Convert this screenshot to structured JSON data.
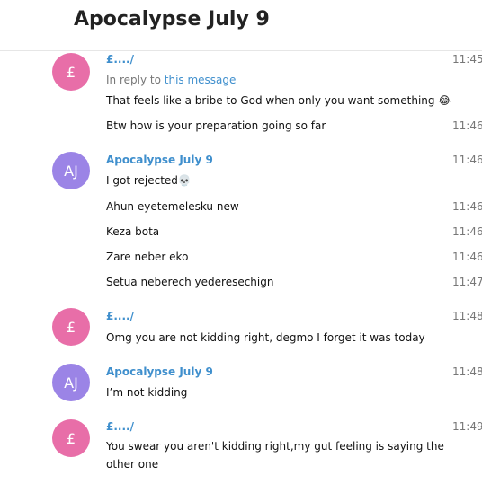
{
  "header": {
    "title": "Apocalypse July 9"
  },
  "colors": {
    "pound_avatar": "#e86ea8",
    "aj_avatar": "#9b84e6",
    "name": "#3f8fcd"
  },
  "groups": [
    {
      "avatar": "£",
      "sender": "£..../",
      "time": "11:45",
      "reply": {
        "prefix": "In reply to",
        "link": "this message"
      },
      "messages": [
        {
          "text": "That feels like a bribe to God when only you want something 😂"
        },
        {
          "text": "Btw how is your preparation going so far",
          "time": "11:46"
        }
      ]
    },
    {
      "avatar": "AJ",
      "sender": "Apocalypse July 9",
      "time": "11:46",
      "messages": [
        {
          "text": "I got rejected💀"
        },
        {
          "text": "Ahun eyetemelesku new",
          "time": "11:46"
        },
        {
          "text": "Keza bota",
          "time": "11:46"
        },
        {
          "text": "Zare neber eko",
          "time": "11:46"
        },
        {
          "text": "Setua neberech yederesechign",
          "time": "11:47"
        }
      ]
    },
    {
      "avatar": "£",
      "sender": "£..../",
      "time": "11:48",
      "messages": [
        {
          "text": "Omg you are not kidding right, degmo I forget it was today"
        }
      ]
    },
    {
      "avatar": "AJ",
      "sender": "Apocalypse July 9",
      "time": "11:48",
      "messages": [
        {
          "text": "I’m not kidding"
        }
      ]
    },
    {
      "avatar": "£",
      "sender": "£..../",
      "time": "11:49",
      "messages": [
        {
          "text": "You swear you aren't kidding right,my gut feeling is saying the other one"
        }
      ]
    }
  ]
}
